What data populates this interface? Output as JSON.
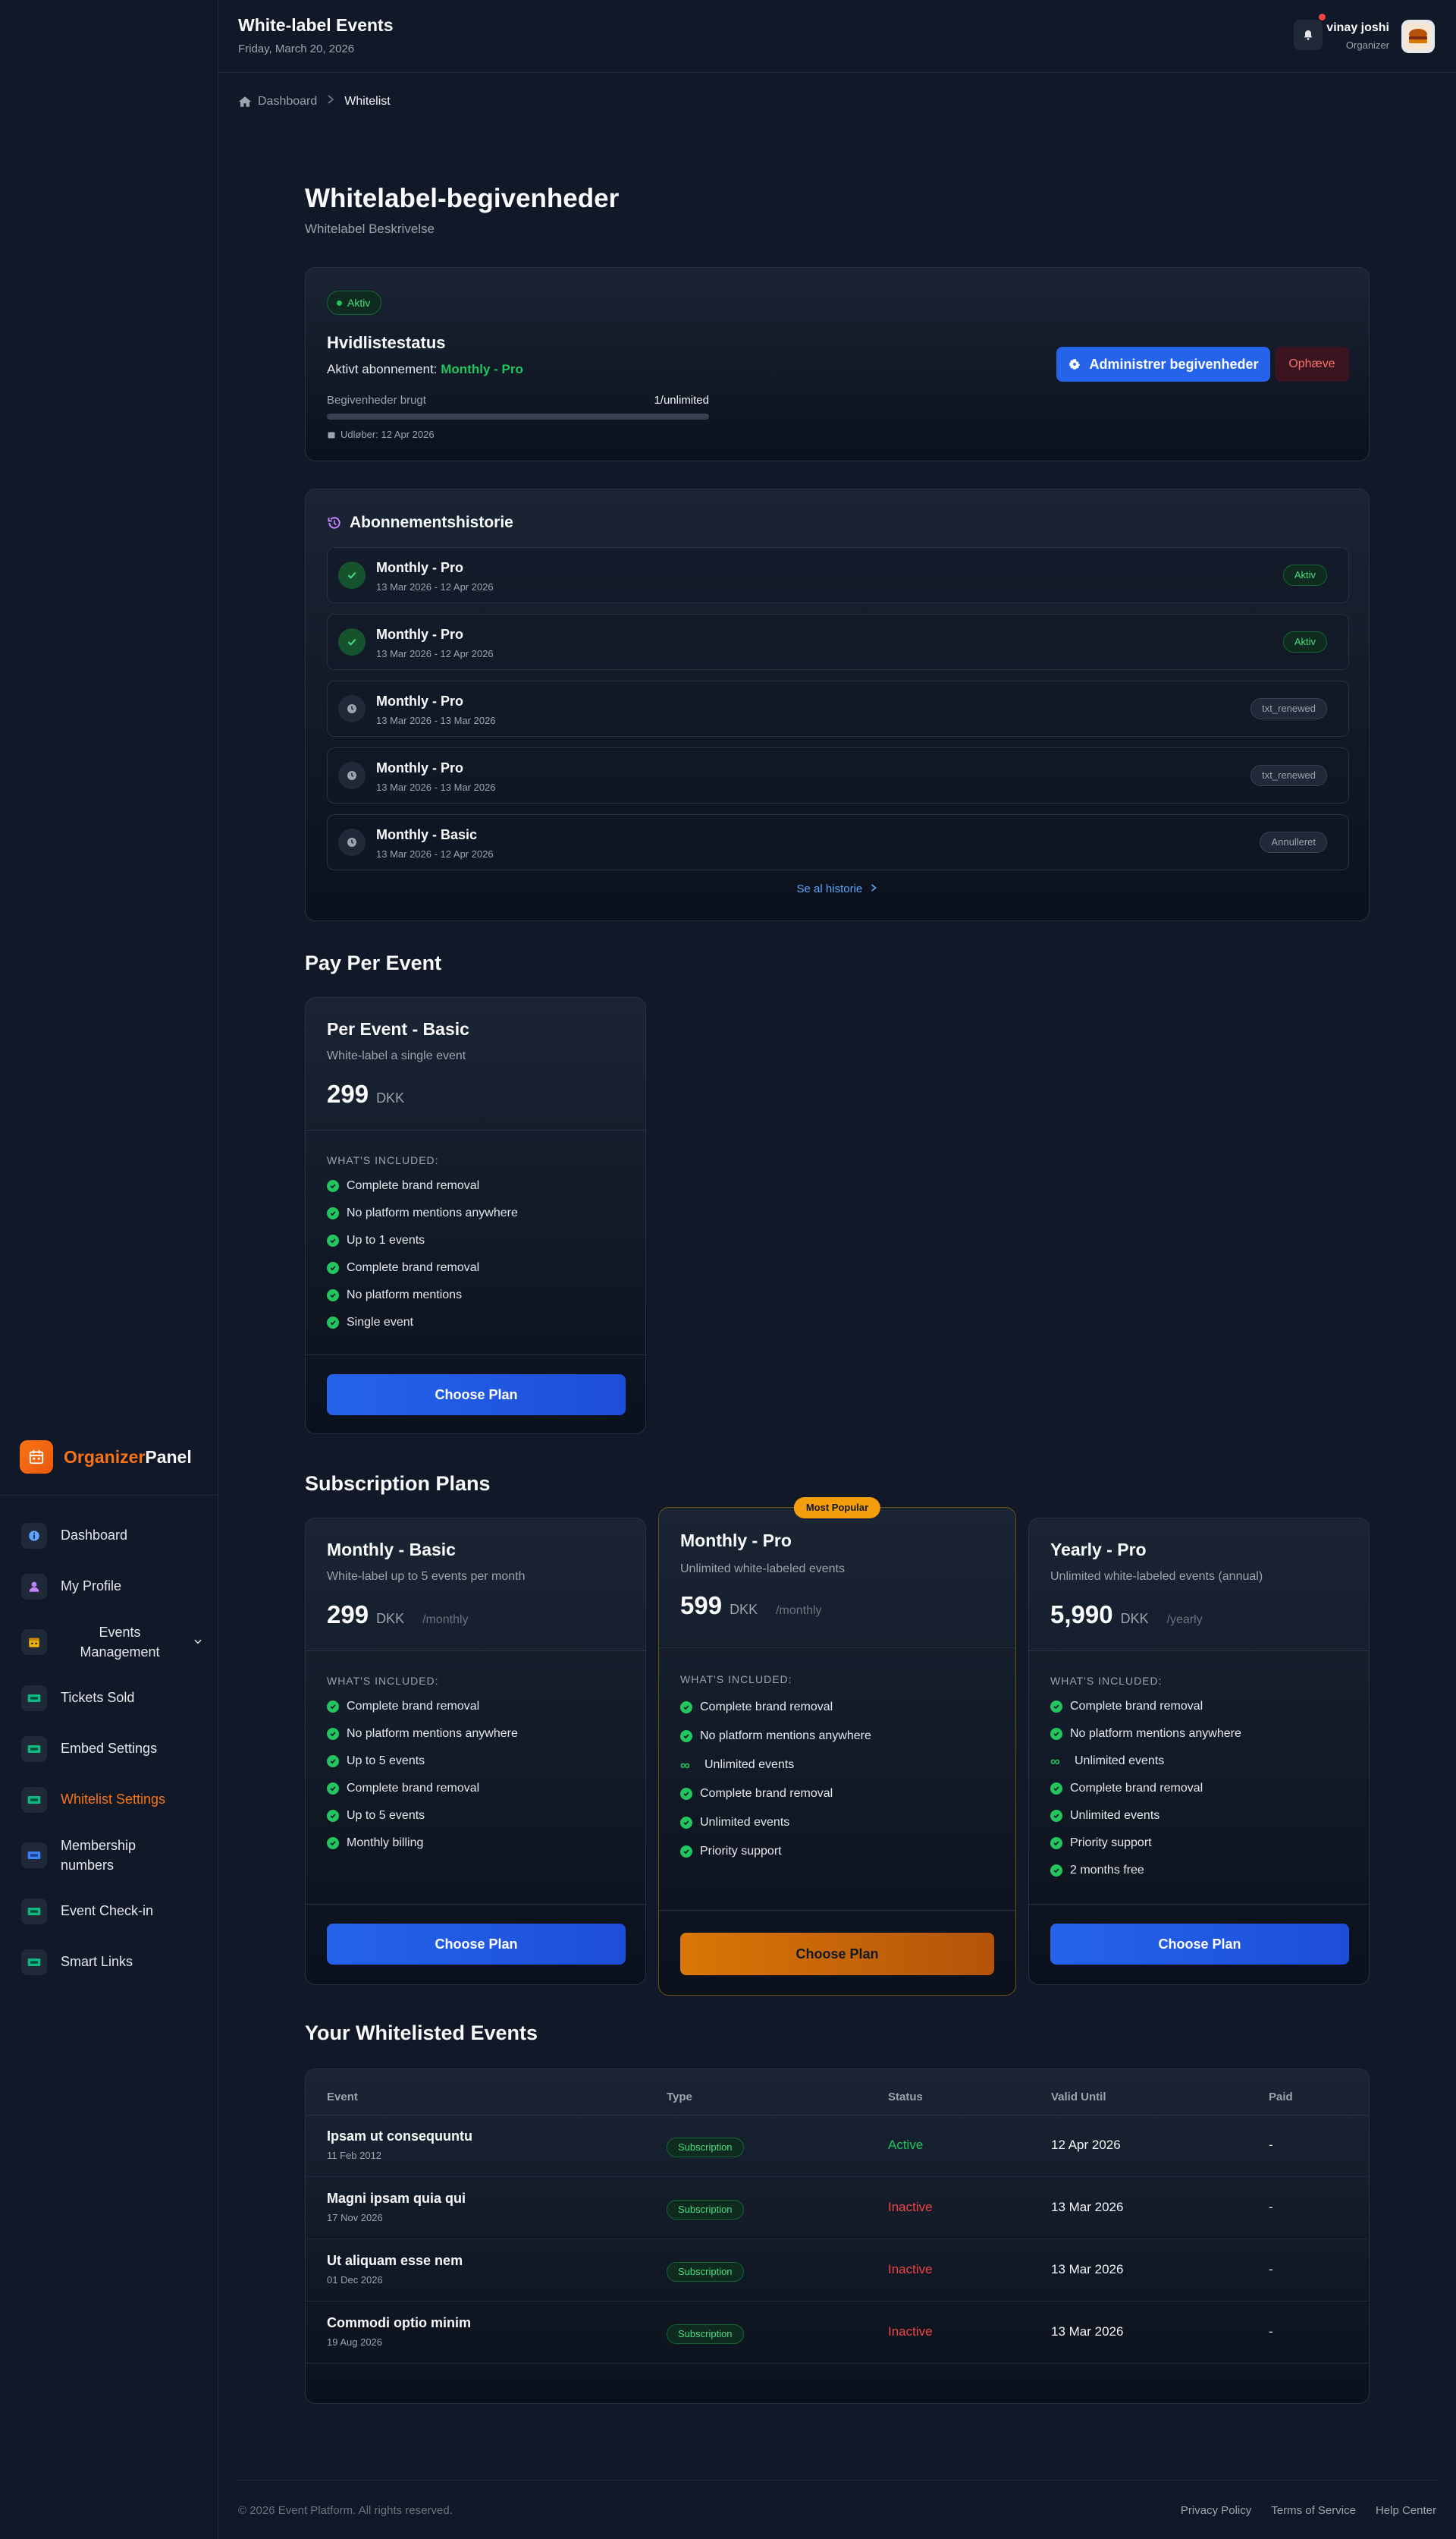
{
  "header": {
    "title": "White-label Events",
    "date": "Friday, March 20, 2026",
    "user_name": "vinay joshi",
    "user_role": "Organizer"
  },
  "sidebar": {
    "brand_accent": "Organizer",
    "brand_rest": "Panel",
    "items": [
      {
        "label": "Dashboard",
        "icon": "dashboard-icon"
      },
      {
        "label": "My Profile",
        "icon": "user-icon"
      },
      {
        "label": "Events Management",
        "icon": "calendar-icon"
      },
      {
        "label": "Tickets Sold",
        "icon": "ticket-icon"
      },
      {
        "label": "Embed Settings",
        "icon": "ticket-icon"
      },
      {
        "label": "Whitelist Settings",
        "icon": "ticket-icon"
      },
      {
        "label": "Membership numbers",
        "icon": "card-icon"
      },
      {
        "label": "Event Check-in",
        "icon": "ticket-icon"
      },
      {
        "label": "Smart Links",
        "icon": "ticket-icon"
      }
    ]
  },
  "breadcrumb": {
    "home": "Dashboard",
    "current": "Whitelist"
  },
  "page": {
    "title": "Whitelabel-begivenheder",
    "description": "Whitelabel Beskrivelse"
  },
  "status": {
    "badge": "Aktiv",
    "title": "Hvidlistestatus",
    "subscription_prefix": "Aktivt abonnement:",
    "subscription_plan": "Monthly - Pro",
    "used_label": "Begivenheder brugt",
    "used_value": "1/unlimited",
    "usage_fraction": 0,
    "expiry": "Udløber: 12 Apr 2026",
    "manage_button": "Administrer begivenheder",
    "cancel_button": "Ophæve"
  },
  "history": {
    "title": "Abonnementshistorie",
    "see_all": "Se al historie",
    "rows": [
      {
        "name": "Monthly - Pro",
        "dates": "13 Mar 2026 - 12 Apr 2026",
        "status": "Aktiv",
        "kind": "ok"
      },
      {
        "name": "Monthly - Pro",
        "dates": "13 Mar 2026 - 12 Apr 2026",
        "status": "Aktiv",
        "kind": "ok"
      },
      {
        "name": "Monthly - Pro",
        "dates": "13 Mar 2026 - 13 Mar 2026",
        "status": "txt_renewed",
        "kind": "clock"
      },
      {
        "name": "Monthly - Pro",
        "dates": "13 Mar 2026 - 13 Mar 2026",
        "status": "txt_renewed",
        "kind": "clock"
      },
      {
        "name": "Monthly - Basic",
        "dates": "13 Mar 2026 - 12 Apr 2026",
        "status": "Annulleret",
        "kind": "clock"
      }
    ]
  },
  "pay_per_event": {
    "section_title": "Pay Per Event",
    "plan": {
      "name": "Per Event - Basic",
      "desc": "White-label a single event",
      "price": "299",
      "currency": "DKK",
      "included_label": "WHAT'S INCLUDED:",
      "features": [
        "Complete brand removal",
        "No platform mentions anywhere",
        "Up to 1 events",
        "Complete brand removal",
        "No platform mentions",
        "Single event"
      ],
      "button": "Choose Plan"
    }
  },
  "subscription": {
    "section_title": "Subscription Plans",
    "popular_label": "Most Popular",
    "plans": [
      {
        "name": "Monthly - Basic",
        "desc": "White-label up to 5 events per month",
        "price": "299",
        "currency": "DKK",
        "period": "/monthly",
        "included_label": "WHAT'S INCLUDED:",
        "features": [
          "Complete brand removal",
          "No platform mentions anywhere",
          "Up to 5 events",
          "Complete brand removal",
          "Up to 5 events",
          "Monthly billing"
        ],
        "button": "Choose Plan"
      },
      {
        "name": "Monthly - Pro",
        "desc": "Unlimited white-labeled events",
        "price": "599",
        "currency": "DKK",
        "period": "/monthly",
        "included_label": "WHAT'S INCLUDED:",
        "features": [
          "Complete brand removal",
          "No platform mentions anywhere",
          "Unlimited events",
          "Complete brand removal",
          "Unlimited events",
          "Priority support"
        ],
        "button": "Choose Plan"
      },
      {
        "name": "Yearly - Pro",
        "desc": "Unlimited white-labeled events (annual)",
        "price": "5,990",
        "currency": "DKK",
        "period": "/yearly",
        "included_label": "WHAT'S INCLUDED:",
        "features": [
          "Complete brand removal",
          "No platform mentions anywhere",
          "Unlimited events",
          "Complete brand removal",
          "Unlimited events",
          "Priority support",
          "2 months free"
        ],
        "button": "Choose Plan"
      }
    ]
  },
  "events": {
    "section_title": "Your Whitelisted Events",
    "columns": [
      "Event",
      "Type",
      "Status",
      "Valid Until",
      "Paid"
    ],
    "rows": [
      {
        "name": "Ipsam ut consequuntu",
        "date": "11 Feb 2012",
        "type": "Subscription",
        "status": "Active",
        "valid": "12 Apr 2026",
        "paid": "-"
      },
      {
        "name": "Magni ipsam quia qui",
        "date": "17 Nov 2026",
        "type": "Subscription",
        "status": "Inactive",
        "valid": "13 Mar 2026",
        "paid": "-"
      },
      {
        "name": "Ut aliquam esse nem",
        "date": "01 Dec 2026",
        "type": "Subscription",
        "status": "Inactive",
        "valid": "13 Mar 2026",
        "paid": "-"
      },
      {
        "name": "Commodi optio minim",
        "date": "19 Aug 2026",
        "type": "Subscription",
        "status": "Inactive",
        "valid": "13 Mar 2026",
        "paid": "-"
      }
    ]
  },
  "footer": {
    "copyright": "© 2026 Event Platform. All rights reserved.",
    "links": [
      "Privacy Policy",
      "Terms of Service",
      "Help Center"
    ]
  }
}
